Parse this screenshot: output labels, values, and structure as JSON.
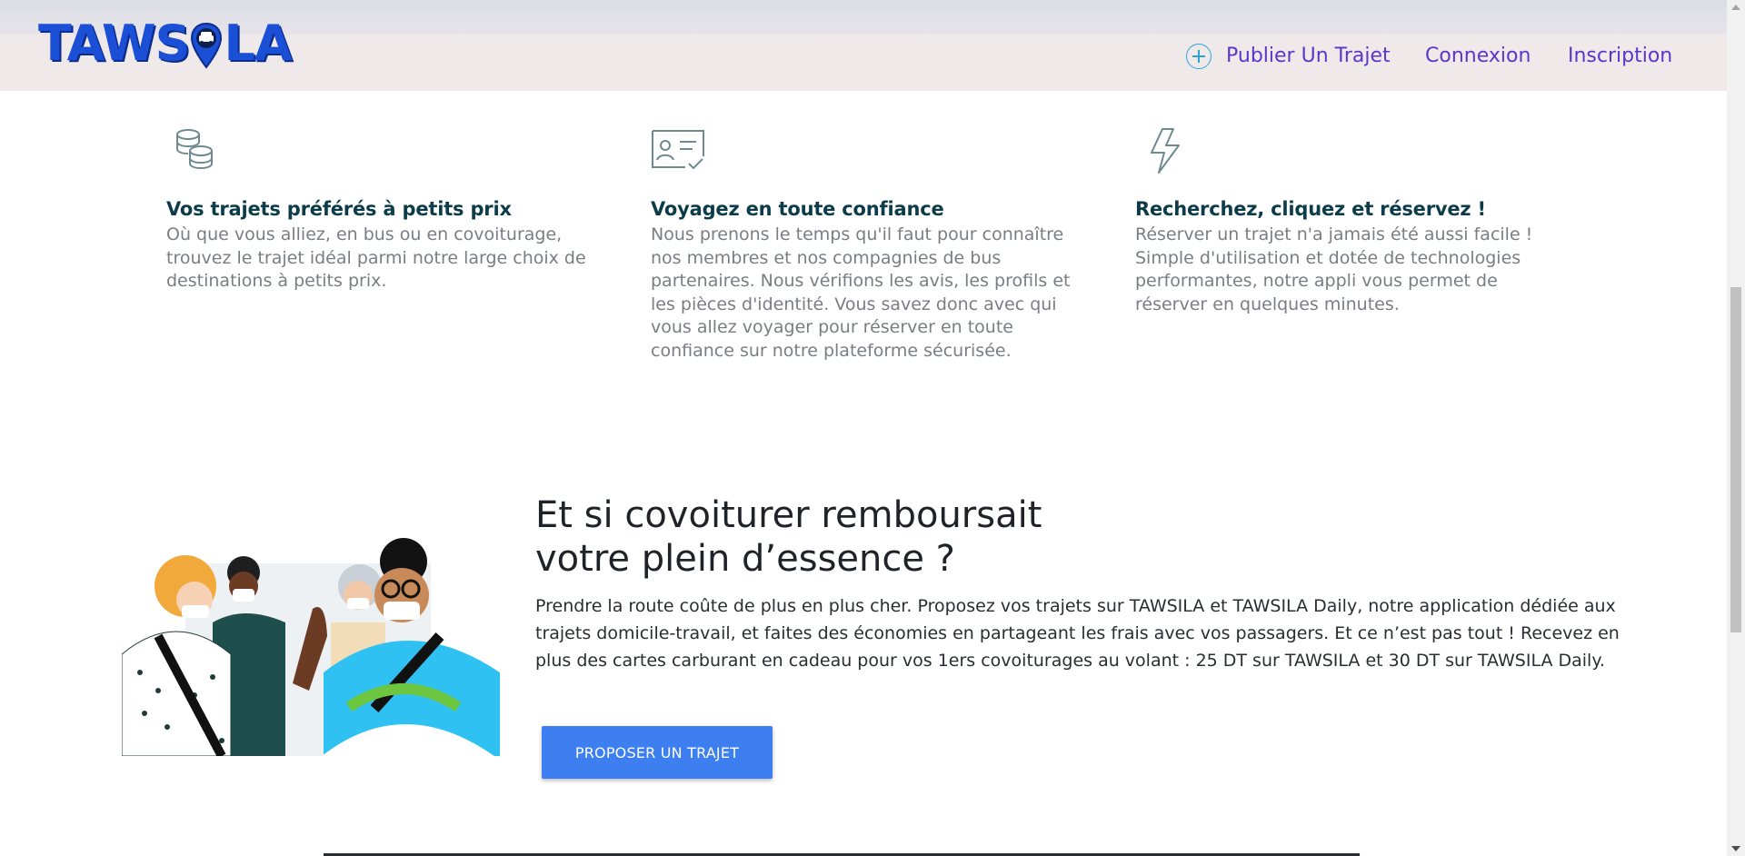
{
  "header": {
    "logo_text_left": "TAWS",
    "logo_text_right": "LA",
    "logo_full": "TAWSILA",
    "nav": {
      "publish": "Publier Un Trajet",
      "login": "Connexion",
      "signup": "Inscription"
    }
  },
  "features": [
    {
      "icon": "coins-icon",
      "title": "Vos trajets préférés à petits prix",
      "text": "Où que vous alliez, en bus ou en covoiturage, trouvez le trajet idéal parmi notre large choix de destinations à petits prix."
    },
    {
      "icon": "verified-id-icon",
      "title": "Voyagez en toute confiance",
      "text": "Nous prenons le temps qu'il faut pour connaître nos membres et nos compagnies de bus partenaires. Nous vérifions les avis, les profils et les pièces d'identité. Vous savez donc avec qui vous allez voyager pour réserver en toute confiance sur notre plateforme sécurisée."
    },
    {
      "icon": "lightning-icon",
      "title": "Recherchez, cliquez et réservez !",
      "text": "Réserver un trajet n'a jamais été aussi facile ! Simple d'utilisation et dotée de technologies performantes, notre appli vous permet de réserver en quelques minutes."
    }
  ],
  "promo": {
    "title_line1": "Et si covoiturer remboursait",
    "title_line2": "votre plein d’essence ?",
    "text": "Prendre la route coûte de plus en plus cher. Proposez vos trajets sur TAWSILA et TAWSILA Daily, notre application dédiée aux trajets domicile-travail, et faites des économies en partageant les frais avec vos passagers. Et ce n’est pas tout ! Recevez en plus des cartes carburant en cadeau pour vos 1ers covoiturages au volant : 25 DT sur TAWSILA et 30 DT sur TAWSILA Daily.",
    "button": "PROPOSER UN TRAJET"
  },
  "colors": {
    "brand_blue": "#1a4fd6",
    "nav_purple": "#5a37c9",
    "cta_blue": "#3d7ff0",
    "feature_title": "#0c3b4a"
  }
}
